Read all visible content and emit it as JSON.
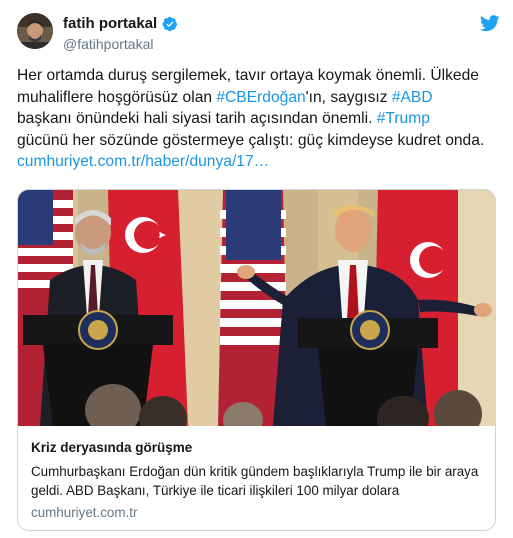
{
  "author": {
    "display_name": "fatih portakal",
    "handle": "@fatihportakal",
    "avatar_icon": "avatar",
    "verified_icon": "verified-badge-icon",
    "app_icon": "twitter-bird-icon"
  },
  "tweet": {
    "line1": "Her ortamda duruş sergilemek, tavır ortaya koymak önemli. Ülkede",
    "line2_pre": "muhaliflere hoşgörüsüz olan ",
    "hashtag1": "#CBErdoğan",
    "line2_post": "'ın, saygısız ",
    "hashtag2": "#ABD",
    "line3": "başkanı önündeki hali siyasi tarih açısından önemli. ",
    "hashtag3": "#Trump",
    "line4": "gücünü her sözünde göstermeye çalıştı: güç kimdeyse kudret onda.",
    "url": "cumhuriyet.com.tr/haber/dunya/17…"
  },
  "card": {
    "title": "Kriz deryasında görüşme",
    "description": "Cumhurbaşkanı Erdoğan dün kritik gündem başlıklarıyla Trump ile bir araya geldi. ABD Başkanı, Türkiye ile ticari ilişkileri 100 milyar dolara",
    "domain": "cumhuriyet.com.tr"
  },
  "colors": {
    "link": "#1b95e0",
    "text": "#14171a",
    "muted": "#657786",
    "border": "#ccd6dd"
  }
}
